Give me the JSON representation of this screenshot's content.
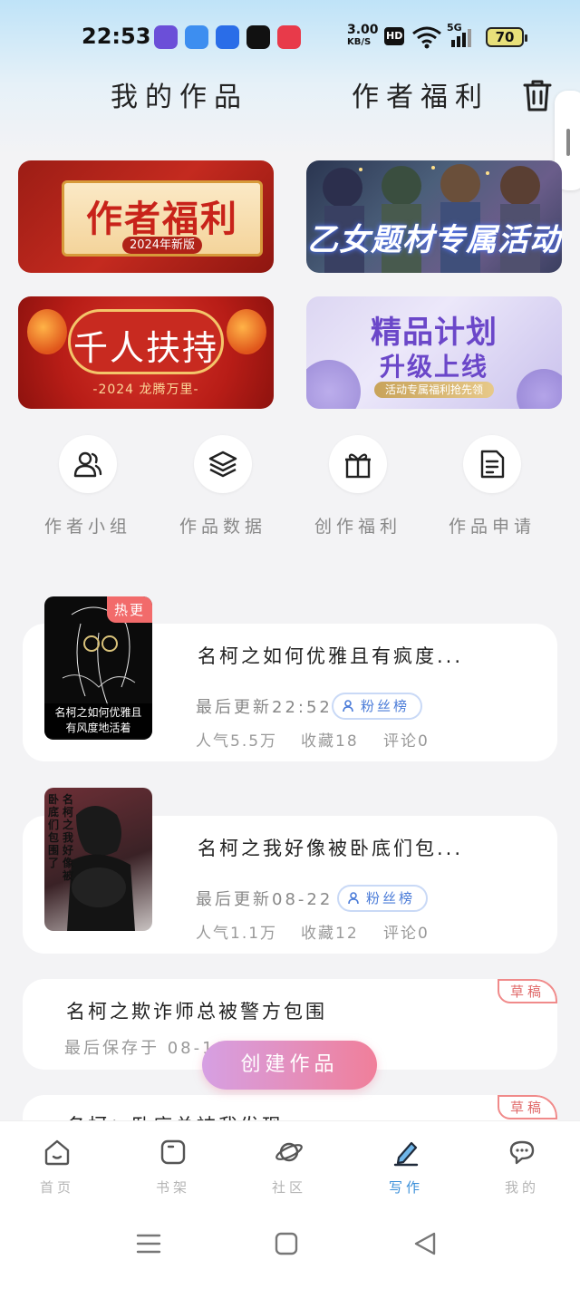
{
  "status_bar": {
    "time": "22:53",
    "speed_value": "3.00",
    "speed_unit": "KB/S",
    "hd": "HD",
    "network": "5G",
    "battery": "70"
  },
  "header": {
    "my_works": "我的作品",
    "author_benefits": "作者福利"
  },
  "banners": [
    {
      "title": "作者福利",
      "subtitle": "2024年新版"
    },
    {
      "title": "乙女题材专属活动"
    },
    {
      "title": "千人扶持",
      "subtitle": "-2024 龙腾万里-"
    },
    {
      "title": "精品计划",
      "subtitle": "升级上线",
      "tag": "活动专属福利抢先领"
    }
  ],
  "quick_actions": [
    {
      "label": "作者小组",
      "icon": "users-icon"
    },
    {
      "label": "作品数据",
      "icon": "layers-icon"
    },
    {
      "label": "创作福利",
      "icon": "gift-icon"
    },
    {
      "label": "作品申请",
      "icon": "document-icon"
    }
  ],
  "works": [
    {
      "title": "名柯之如何优雅且有疯度...",
      "cover_caption_1": "名柯之如何优雅且",
      "cover_caption_2": "有风度地活着",
      "tag": "热更",
      "last_update": "最后更新22:52",
      "fans": "粉丝榜",
      "popularity": "人气5.5万",
      "favorites": "收藏18",
      "comments": "评论0"
    },
    {
      "title": "名柯之我好像被卧底们包...",
      "cover_col_1": "名柯之我好像被",
      "cover_col_2": "卧底们包围了",
      "last_update": "最后更新08-22",
      "fans": "粉丝榜",
      "popularity": "人气1.1万",
      "favorites": "收藏12",
      "comments": "评论0"
    }
  ],
  "drafts": [
    {
      "tag": "草稿",
      "title": "名柯之欺诈师总被警方包围",
      "saved": "最后保存于 08-18"
    },
    {
      "tag": "草稿",
      "title": "名柯：卧底总被我发现..."
    }
  ],
  "create_button": "创建作品",
  "bottom_nav": [
    {
      "label": "首页",
      "icon": "home-icon"
    },
    {
      "label": "书架",
      "icon": "bookshelf-icon"
    },
    {
      "label": "社区",
      "icon": "planet-icon"
    },
    {
      "label": "写作",
      "icon": "write-icon",
      "active": true
    },
    {
      "label": "我的",
      "icon": "chat-icon"
    }
  ],
  "colors": {
    "accent": "#3a8fd9",
    "hot": "#f26b6b",
    "draft": "#e06a6a",
    "create_start": "#d6a0e3",
    "create_end": "#f07f9a"
  }
}
